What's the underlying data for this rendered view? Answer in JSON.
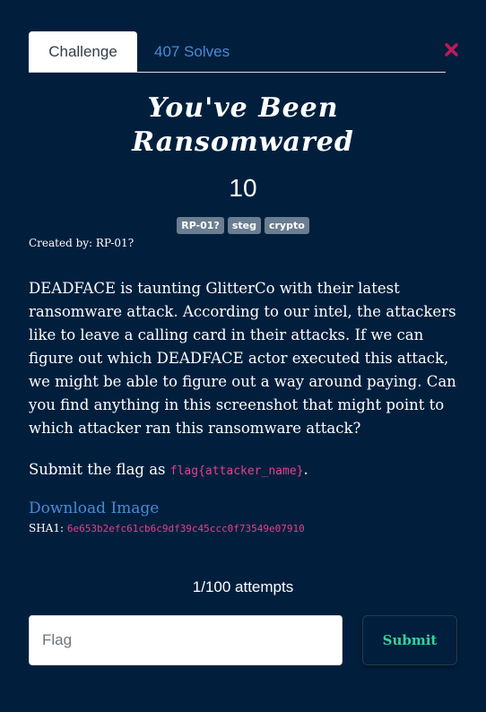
{
  "tabs": [
    {
      "label": "Challenge",
      "active": true
    },
    {
      "label": "407 Solves",
      "active": false
    }
  ],
  "close_icon": "close-icon",
  "challenge": {
    "title_line1": "You've Been",
    "title_line2": "Ransomwared",
    "points": "10",
    "tags": [
      "RP-01?",
      "steg",
      "crypto"
    ],
    "created_by": "Created by: RP-01?",
    "description": "DEADFACE is taunting GlitterCo with their latest ransomware attack. According to our intel, the attackers like to leave a calling card in their attacks. If we can figure out which DEADFACE actor executed this attack, we might be able to figure out a way around paying. Can you find anything in this screenshot that might point to which attacker ran this ransomware attack?",
    "submit_prefix": "Submit the flag as ",
    "flag_format": "flag{attacker_name}",
    "submit_suffix": ".",
    "download_label": "Download Image",
    "sha1_label": "SHA1:",
    "sha1_value": "6e653b2efc61cb6c9df39c45ccc0f73549e07910"
  },
  "attempts": "1/100 attempts",
  "flag_input": {
    "placeholder": "Flag",
    "value": ""
  },
  "submit_label": "Submit",
  "colors": {
    "background": "#011f3d",
    "link": "#4a8ad6",
    "code": "#e83e8c",
    "submit_text": "#35d39a",
    "close": "#c2185b"
  }
}
